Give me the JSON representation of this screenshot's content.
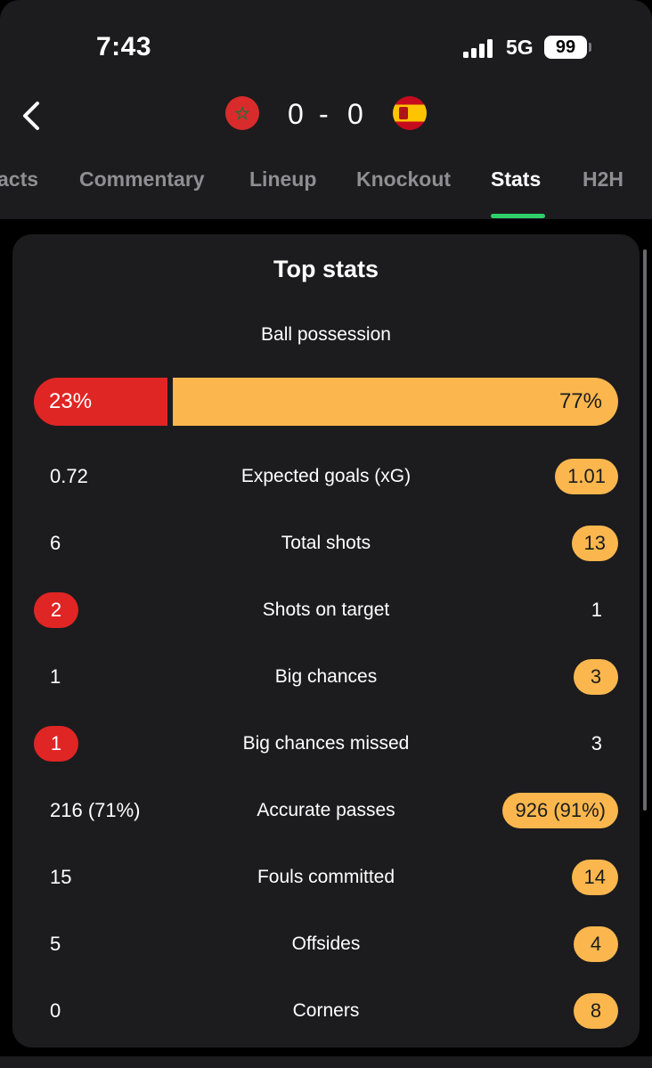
{
  "status_bar": {
    "time": "7:43",
    "network": "5G",
    "battery": "99"
  },
  "match": {
    "home_flag_icon": "morocco-flag-icon",
    "away_flag_icon": "spain-flag-icon",
    "home_score": "0",
    "separator": "-",
    "away_score": "0"
  },
  "tabs": [
    {
      "label": "acts"
    },
    {
      "label": "Commentary"
    },
    {
      "label": "Lineup"
    },
    {
      "label": "Knockout"
    },
    {
      "label": "Stats",
      "active": true
    },
    {
      "label": "H2H"
    }
  ],
  "top_stats": {
    "title": "Top stats",
    "possession": {
      "label": "Ball possession",
      "home": "23%",
      "away": "77%",
      "home_fraction": 0.23
    },
    "rows": [
      {
        "label": "Expected goals (xG)",
        "home": "0.72",
        "away": "1.01",
        "leader": "away"
      },
      {
        "label": "Total shots",
        "home": "6",
        "away": "13",
        "leader": "away"
      },
      {
        "label": "Shots on target",
        "home": "2",
        "away": "1",
        "leader": "home"
      },
      {
        "label": "Big chances",
        "home": "1",
        "away": "3",
        "leader": "away"
      },
      {
        "label": "Big chances missed",
        "home": "1",
        "away": "3",
        "leader": "home"
      },
      {
        "label": "Accurate passes",
        "home": "216 (71%)",
        "away": "926 (91%)",
        "leader": "away"
      },
      {
        "label": "Fouls committed",
        "home": "15",
        "away": "14",
        "leader": "away"
      },
      {
        "label": "Offsides",
        "home": "5",
        "away": "4",
        "leader": "away"
      },
      {
        "label": "Corners",
        "home": "0",
        "away": "8",
        "leader": "away"
      }
    ]
  },
  "colors": {
    "home_accent": "#e02525",
    "away_accent": "#fbb74e",
    "active_tab_indicator": "#2fd069",
    "card_background": "#1c1c1e"
  }
}
